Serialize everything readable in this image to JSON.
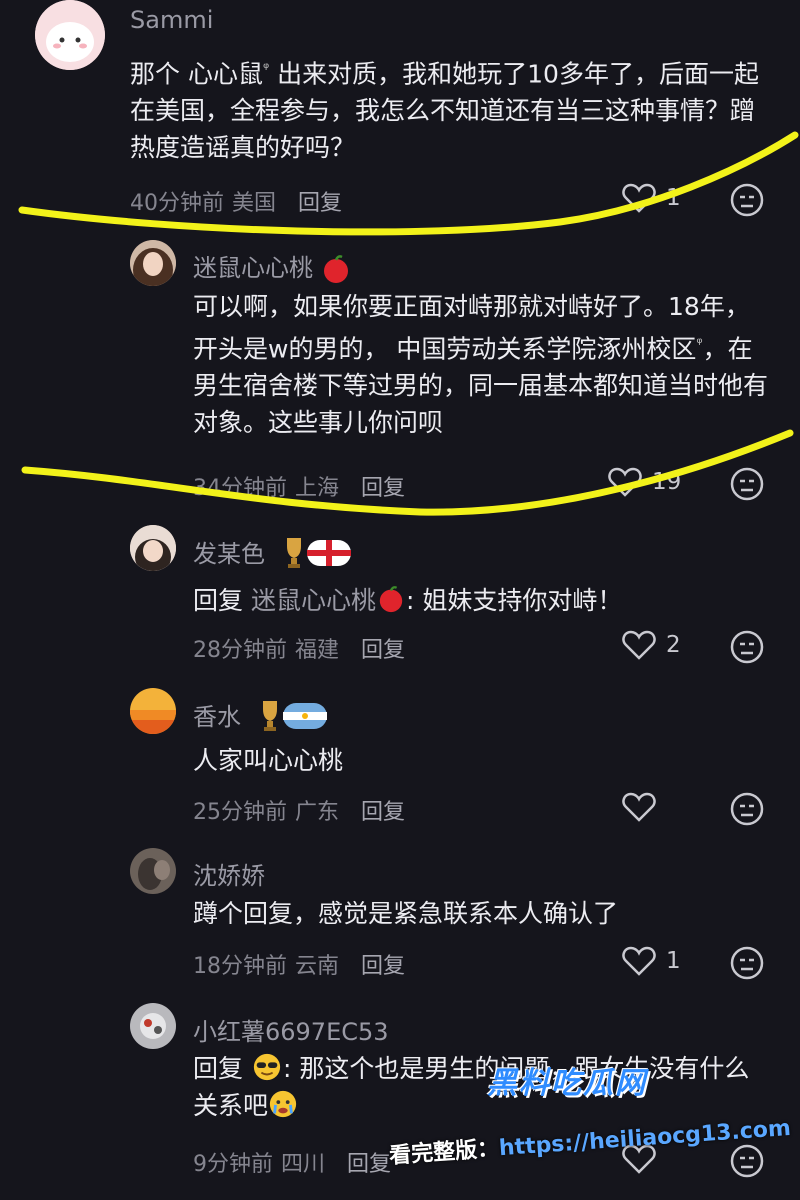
{
  "comments": [
    {
      "user": "Sammi",
      "text_parts": [
        "那个 心心鼠",
        " 出来对质，我和她玩了10多年了，后面一起在美国，全程参与，我怎么不知道还有当三这种事情？蹭热度造谣真的好吗？"
      ],
      "time": "40分钟前",
      "location": "美国",
      "reply_label": "回复",
      "likes": "1",
      "avatar_color": "#f7d6da"
    },
    {
      "user": "迷鼠心心桃",
      "text_parts": [
        "可以啊，如果你要正面对峙那就对峙好了。18年，开头是w的男的，  中国劳动关系学院涿州校区",
        "，在男生宿舍楼下等过男的，同一届基本都知道当时他有对象。这些事儿你问呗"
      ],
      "time": "34分钟前",
      "location": "上海",
      "reply_label": "回复",
      "likes": "19",
      "avatar_color": "#7a5c4a"
    },
    {
      "user": "发某色",
      "reply_prefix": "回复",
      "reply_target": "迷鼠心心桃",
      "text": ": 姐妹支持你对峙！",
      "time": "28分钟前",
      "location": "福建",
      "reply_label": "回复",
      "likes": "2",
      "avatar_color": "#d8c2b8"
    },
    {
      "user": "香水",
      "text": "人家叫心心桃",
      "time": "25分钟前",
      "location": "广东",
      "reply_label": "回复",
      "likes": "",
      "avatar_color": "#f1a531"
    },
    {
      "user": "沈娇娇",
      "text": "蹲个回复，感觉是紧急联系本人确认了",
      "time": "18分钟前",
      "location": "云南",
      "reply_label": "回复",
      "likes": "1",
      "avatar_color": "#5a4f4a"
    },
    {
      "user": "小红薯6697EC53",
      "reply_prefix": "回复",
      "text_parts": [
        ": 那这个也是男生的问题，跟女生没有什么关系吧"
      ],
      "time": "9分钟前",
      "location": "四川",
      "reply_label": "回复",
      "likes": "",
      "avatar_color": "#a4a4a8"
    }
  ],
  "watermark": {
    "brand": "黑料吃瓜网",
    "label": "看完整版：",
    "url": "https://heiliaocg13.com"
  },
  "colors": {
    "background": "#15151c",
    "highlight": "#f2f21a",
    "watermark_blue": "#2f8cff"
  }
}
